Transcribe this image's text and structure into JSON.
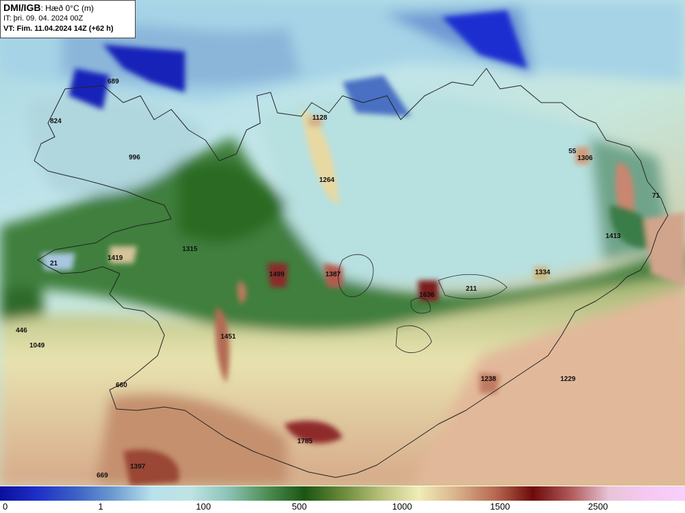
{
  "header": {
    "brand": "DMI/IGB",
    "variable": ": Hæð 0°C (m)",
    "init_time": "IT: þri. 09. 04. 2024 00Z",
    "valid_time": "VT: Fim. 11.04.2024 14Z (+62 h)"
  },
  "legend": {
    "ticks": [
      {
        "label": "0",
        "value": 0
      },
      {
        "label": "1",
        "value": 1
      },
      {
        "label": "100",
        "value": 100
      },
      {
        "label": "500",
        "value": 500
      },
      {
        "label": "1000",
        "value": 1000
      },
      {
        "label": "1500",
        "value": 1500
      },
      {
        "label": "2500",
        "value": 2500
      }
    ],
    "colors": [
      "#0a0f9e",
      "#1f2fc8",
      "#3b62c4",
      "#6f9cd0",
      "#b8e2ec",
      "#bfe3e3",
      "#8cc3b6",
      "#4f8f55",
      "#1b5511",
      "#6a8a3a",
      "#b7c07a",
      "#f0ecb8",
      "#d9b28a",
      "#b76a52",
      "#6e0a0a",
      "#b05a5a",
      "#e8c4d6",
      "#f6c8f2",
      "#f7d0fa"
    ]
  },
  "elevation_labels": [
    {
      "text": "689"
    },
    {
      "text": "824"
    },
    {
      "text": "996"
    },
    {
      "text": "1128"
    },
    {
      "text": "1264"
    },
    {
      "text": "55"
    },
    {
      "text": "1306"
    },
    {
      "text": "71"
    },
    {
      "text": "1413"
    },
    {
      "text": "1315"
    },
    {
      "text": "1419"
    },
    {
      "text": "21"
    },
    {
      "text": "1499"
    },
    {
      "text": "1387"
    },
    {
      "text": "1334"
    },
    {
      "text": "211"
    },
    {
      "text": "1636"
    },
    {
      "text": "446"
    },
    {
      "text": "1049"
    },
    {
      "text": "1451"
    },
    {
      "text": "660"
    },
    {
      "text": "1238"
    },
    {
      "text": "1229"
    },
    {
      "text": "1785"
    },
    {
      "text": "669"
    },
    {
      "text": "1397"
    }
  ]
}
